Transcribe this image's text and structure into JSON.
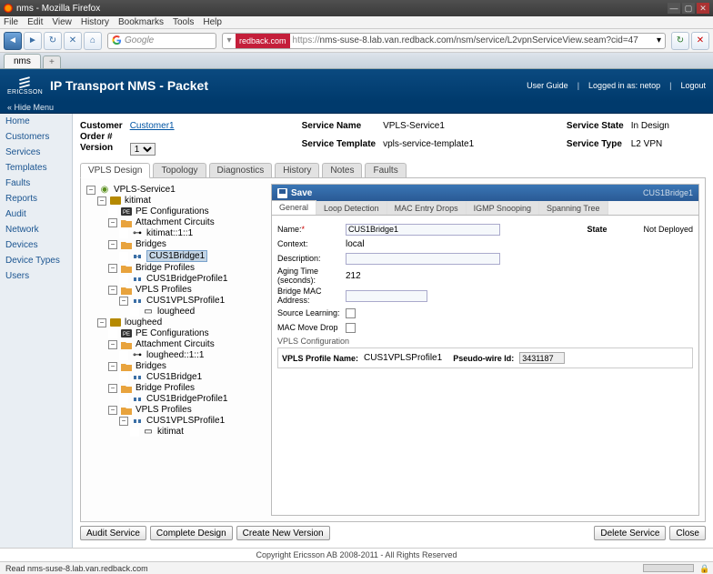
{
  "window": {
    "title": "nms - Mozilla Firefox"
  },
  "browser": {
    "menus": [
      "File",
      "Edit",
      "View",
      "History",
      "Bookmarks",
      "Tools",
      "Help"
    ],
    "search_placeholder": "Google",
    "url_badge": "redback.com",
    "url_https": "https://",
    "url_rest": "nms-suse-8.lab.van.redback.com/nsm/service/L2vpnServiceView.seam?cid=47",
    "tab": "nms",
    "status": "Read nms-suse-8.lab.van.redback.com"
  },
  "app": {
    "vendor": "ERICSSON",
    "title": "IP Transport NMS - Packet",
    "hide": "« Hide Menu",
    "header_links": {
      "guide": "User Guide",
      "logged": "Logged in as: netop",
      "logout": "Logout"
    }
  },
  "sidebar": {
    "items": [
      "Home",
      "Customers",
      "Services",
      "Templates",
      "Faults",
      "Reports",
      "Audit",
      "Network",
      "Devices",
      "Device Types",
      "Users"
    ]
  },
  "info": {
    "customer_lbl": "Customer",
    "customer": "Customer1",
    "order_lbl": "Order #",
    "order": "",
    "version_lbl": "Version",
    "version": "1",
    "svcname_lbl": "Service Name",
    "svcname": "VPLS-Service1",
    "svctpl_lbl": "Service Template",
    "svctpl": "vpls-service-template1",
    "svcstate_lbl": "Service State",
    "svcstate": "In Design",
    "svctype_lbl": "Service Type",
    "svctype": "L2 VPN"
  },
  "svc_tabs": [
    "VPLS Design",
    "Topology",
    "Diagnostics",
    "History",
    "Notes",
    "Faults"
  ],
  "tree": {
    "root": "VPLS-Service1",
    "ne1": "kitimat",
    "pecfg": "PE Configurations",
    "attach": "Attachment Circuits",
    "ac1": "kitimat::1::1",
    "bridges": "Bridges",
    "br1": "CUS1Bridge1",
    "bprof": "Bridge Profiles",
    "bp1": "CUS1BridgeProfile1",
    "vprof": "VPLS Profiles",
    "vp1": "CUS1VPLSProfile1",
    "vp1child": "lougheed",
    "ne2": "lougheed",
    "ac2": "lougheed::1::1",
    "br2": "CUS1Bridge1",
    "bp2": "CUS1BridgeProfile1",
    "vp2": "CUS1VPLSProfile1",
    "vp2child": "kitimat"
  },
  "form": {
    "save": "Save",
    "crumb": "CUS1Bridge1",
    "inner_tabs": [
      "General",
      "Loop Detection",
      "MAC Entry Drops",
      "IGMP Snooping",
      "Spanning Tree"
    ],
    "name_lbl": "Name:",
    "name": "CUS1Bridge1",
    "state_lbl": "State",
    "state": "Not Deployed",
    "ctx_lbl": "Context:",
    "ctx": "local",
    "desc_lbl": "Description:",
    "desc": "",
    "aging_lbl": "Aging Time (seconds):",
    "aging": "212",
    "bmac_lbl": "Bridge MAC Address:",
    "bmac": "",
    "srclearn_lbl": "Source Learning:",
    "macmove_lbl": "MAC Move Drop",
    "vpls_section": "VPLS Configuration",
    "vpls_prof_lbl": "VPLS Profile Name:",
    "vpls_prof": "CUS1VPLSProfile1",
    "pw_lbl": "Pseudo-wire Id:",
    "pw": "3431187"
  },
  "buttons": {
    "audit": "Audit Service",
    "complete": "Complete Design",
    "newver": "Create New Version",
    "delete": "Delete Service",
    "close": "Close"
  },
  "copyright": "Copyright Ericsson AB 2008-2011 - All Rights Reserved"
}
